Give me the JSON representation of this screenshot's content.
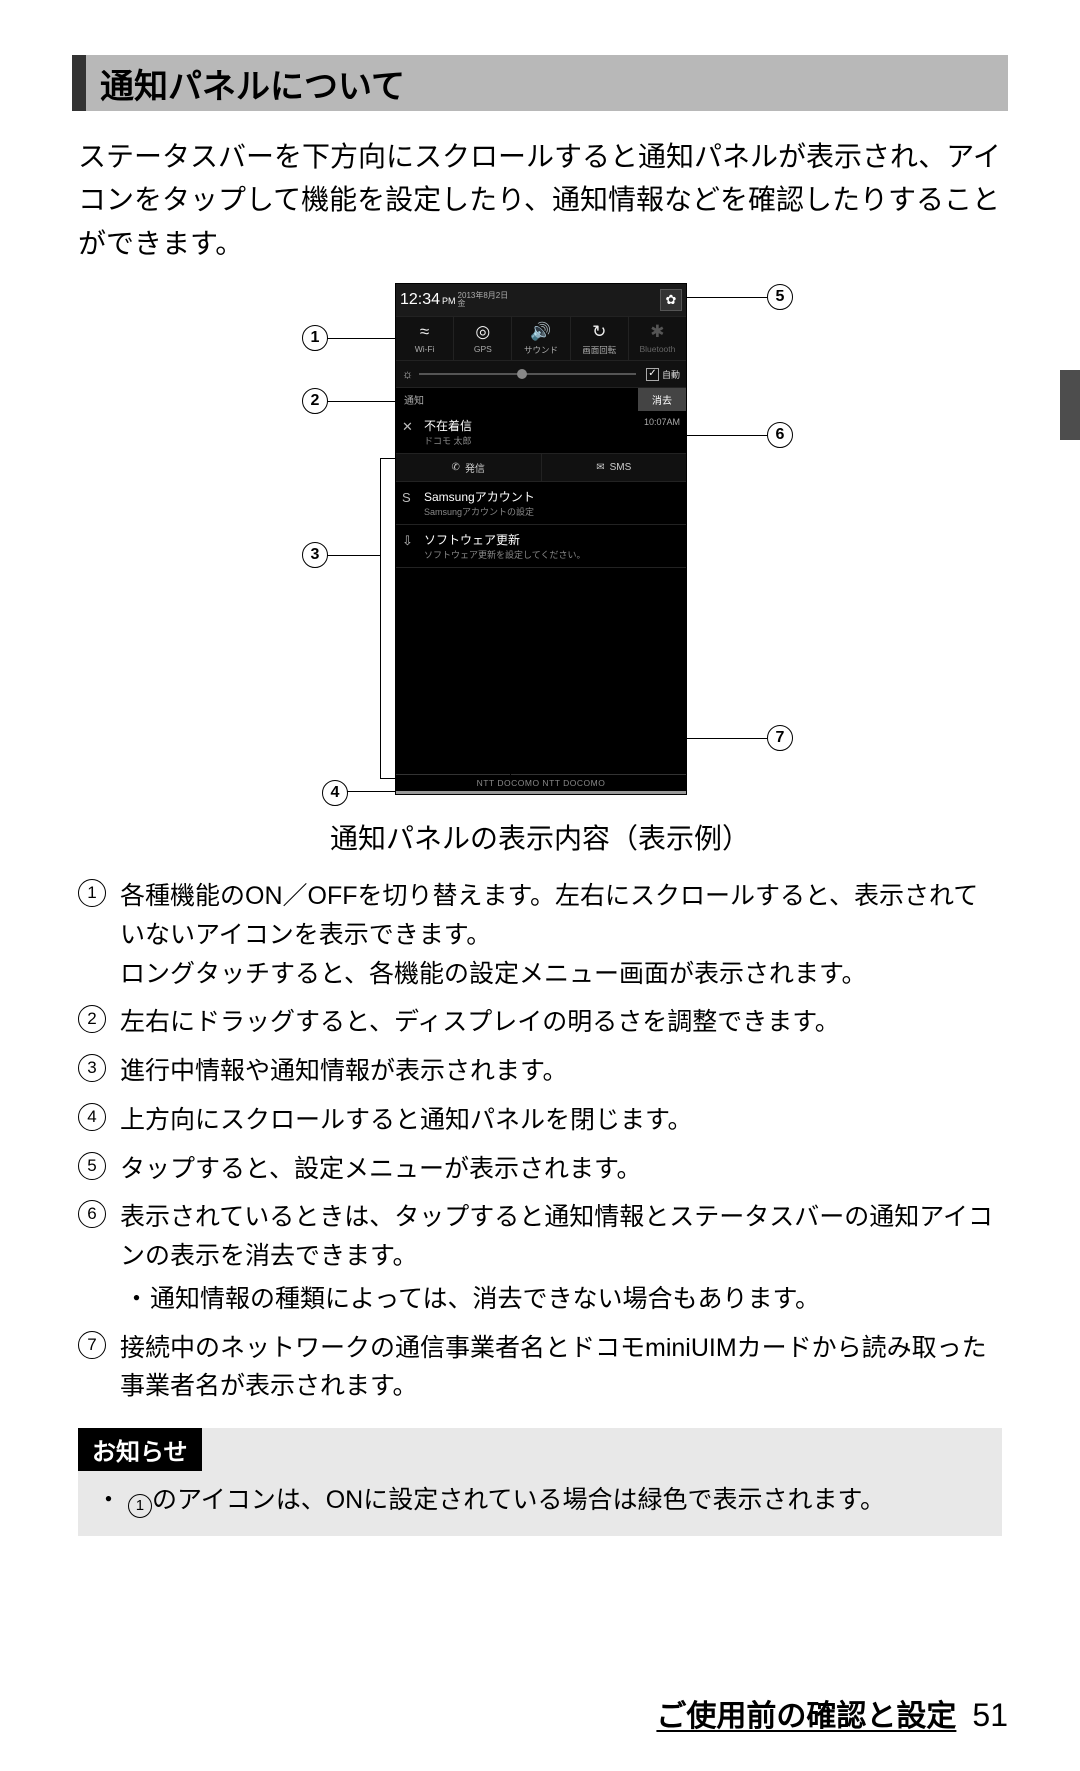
{
  "header": {
    "title": "通知パネルについて"
  },
  "intro": "ステータスバーを下方向にスクロールすると通知パネルが表示され、アイコンをタップして機能を設定したり、通知情報などを確認したりすることができます。",
  "diagram": {
    "time": "12:34",
    "time_suffix": "PM",
    "date_line1": "2013年8月2日",
    "date_line2": "金",
    "toggles": [
      {
        "icon": "wifi-icon",
        "glyph": "≈",
        "label": "Wi-Fi"
      },
      {
        "icon": "gps-icon",
        "glyph": "◎",
        "label": "GPS"
      },
      {
        "icon": "sound-icon",
        "glyph": "🔊",
        "label": "サウンド"
      },
      {
        "icon": "rotate-icon",
        "glyph": "↻",
        "label": "画面回転"
      },
      {
        "icon": "bluetooth-icon",
        "glyph": "✱",
        "label": "Bluetooth"
      }
    ],
    "brightness_auto": "自動",
    "notif_tab": "通知",
    "clear_tab": "消去",
    "notifications": [
      {
        "icon": "missed-call-icon",
        "glyph": "✕",
        "title": "不在着信",
        "sub": "ドコモ 太郎",
        "ts": "10:07AM"
      },
      {
        "icon": "samsung-icon",
        "glyph": "S",
        "title": "Samsungアカウント",
        "sub": "Samsungアカウントの設定",
        "ts": ""
      },
      {
        "icon": "update-icon",
        "glyph": "⇩",
        "title": "ソフトウェア更新",
        "sub": "ソフトウェア更新を設定してください。",
        "ts": ""
      }
    ],
    "actions": [
      {
        "icon": "phone-icon",
        "glyph": "✆",
        "label": "発信"
      },
      {
        "icon": "sms-icon",
        "glyph": "✉",
        "label": "SMS"
      }
    ],
    "carrier": "NTT DOCOMO NTT DOCOMO",
    "callouts": [
      "1",
      "2",
      "3",
      "4",
      "5",
      "6",
      "7"
    ]
  },
  "caption": "通知パネルの表示内容（表示例）",
  "items": [
    {
      "n": "1",
      "text": "各種機能のON／OFFを切り替えます。左右にスクロールすると、表示されていないアイコンを表示できます。\nロングタッチすると、各機能の設定メニュー画面が表示されます。"
    },
    {
      "n": "2",
      "text": "左右にドラッグすると、ディスプレイの明るさを調整できます。"
    },
    {
      "n": "3",
      "text": "進行中情報や通知情報が表示されます。"
    },
    {
      "n": "4",
      "text": "上方向にスクロールすると通知パネルを閉じます。"
    },
    {
      "n": "5",
      "text": "タップすると、設定メニューが表示されます。"
    },
    {
      "n": "6",
      "text": "表示されているときは、タップすると通知情報とステータスバーの通知アイコンの表示を消去できます。",
      "sub": "通知情報の種類によっては、消去できない場合もあります。"
    },
    {
      "n": "7",
      "text": "接続中のネットワークの通信事業者名とドコモminiUIMカードから読み取った事業者名が表示されます。"
    }
  ],
  "note": {
    "label": "お知らせ",
    "ref_num": "1",
    "body_before": "・ ",
    "body_after": "のアイコンは、ONに設定されている場合は緑色で表示されます。"
  },
  "footer": {
    "section": "ご使用前の確認と設定",
    "page": "51"
  }
}
